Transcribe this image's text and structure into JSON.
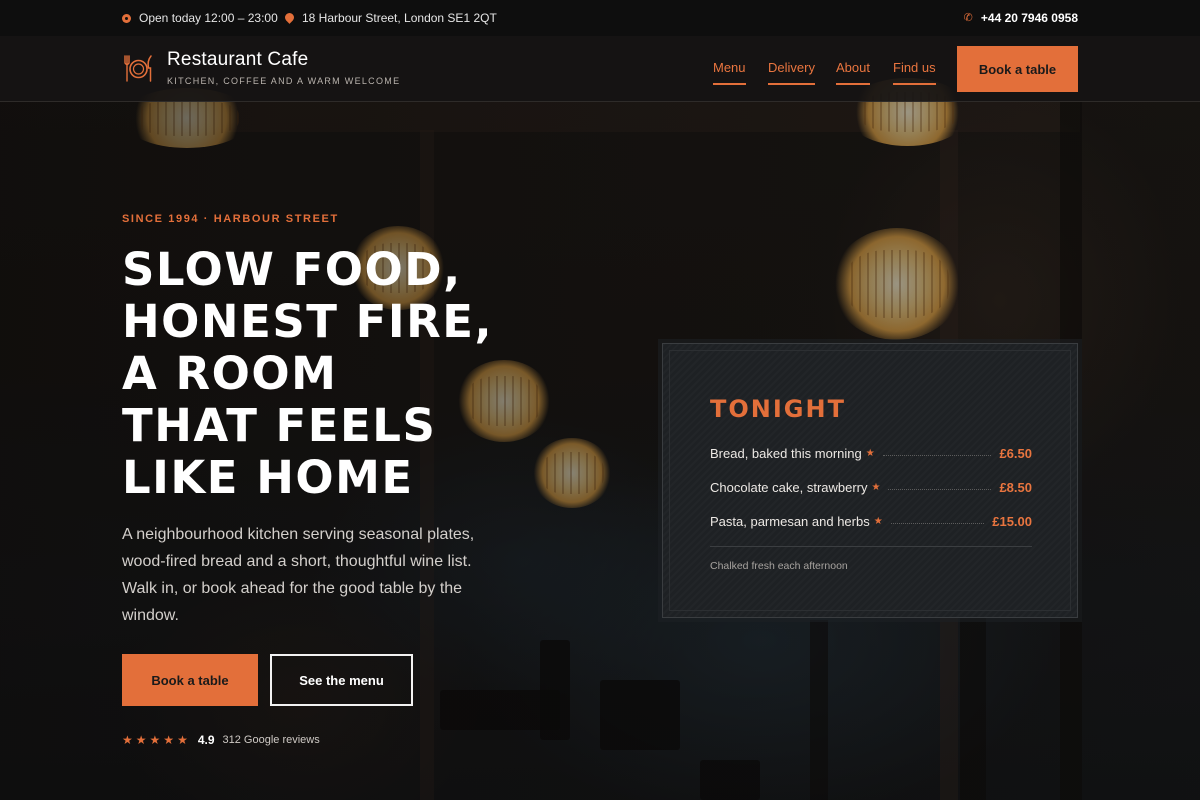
{
  "colors": {
    "accent": "#e36f3a",
    "background": "#141414",
    "card": "#1e2124"
  },
  "topbar": {
    "hours": "Open today 12:00 – 23:00",
    "address": "18 Harbour Street, London SE1 2QT",
    "phone": "+44 20 7946 0958",
    "icons": [
      "clock-icon",
      "map-pin-icon",
      "phone-icon"
    ]
  },
  "header": {
    "brand_name": "Restaurant Cafe",
    "brand_tagline": "KITCHEN, COFFEE AND A WARM WELCOME",
    "logo_icon": "fork-plate-knife-icon",
    "nav": [
      {
        "label": "Menu"
      },
      {
        "label": "Delivery"
      },
      {
        "label": "About"
      },
      {
        "label": "Find us"
      }
    ],
    "cta_label": "Book a table"
  },
  "hero": {
    "eyebrow": "SINCE 1994 · HARBOUR STREET",
    "headline_lines": [
      "SLOW FOOD,",
      "HONEST FIRE,",
      "A ROOM",
      "THAT FEELS",
      "LIKE HOME"
    ],
    "lead": "A neighbourhood kitchen serving seasonal plates, wood-fired bread and a short, thoughtful wine list. Walk in, or book ahead for the good table by the window.",
    "primary_cta": "Book a table",
    "secondary_cta": "See the menu",
    "rating": {
      "stars": 5,
      "score": "4.9",
      "count_label": "312 Google reviews"
    }
  },
  "tonight": {
    "title": "TONIGHT",
    "items": [
      {
        "name": "Bread, baked this morning",
        "price": "£6.50"
      },
      {
        "name": "Chocolate cake, strawberry",
        "price": "£8.50"
      },
      {
        "name": "Pasta, parmesan and herbs",
        "price": "£15.00"
      }
    ],
    "note": "Chalked fresh each afternoon"
  }
}
